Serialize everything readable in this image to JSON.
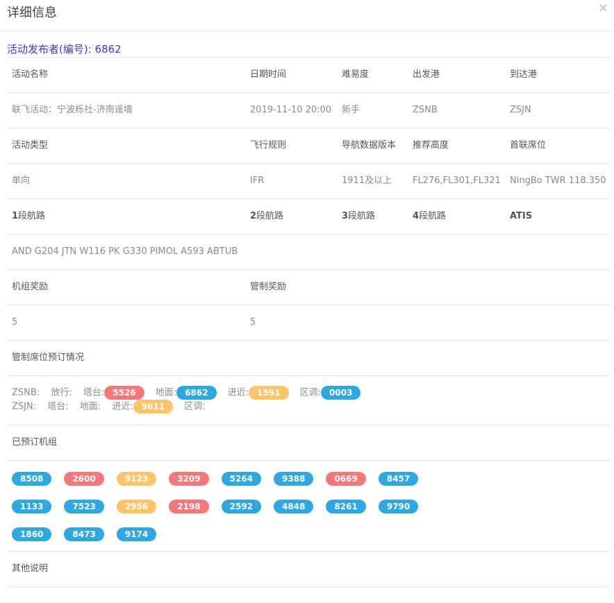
{
  "modal": {
    "title": "详细信息",
    "close_glyph": "×"
  },
  "publisher": {
    "label": "活动发布者(编号): 6862"
  },
  "table": {
    "row1_headers": [
      "活动名称",
      "日期时间",
      "难易度",
      "出发港",
      "到达港"
    ],
    "row1_values": [
      "联飞活动：宁波栎社-济南遥墙",
      "2019-11-10 20:00",
      "新手",
      "ZSNB",
      "ZSJN"
    ],
    "row2_headers": [
      "活动类型",
      "飞行规则",
      "导航数据版本",
      "推荐高度",
      "首联席位"
    ],
    "row2_values": [
      "单向",
      "IFR",
      "1911及以上",
      "FL276,FL301,FL321",
      "NingBo TWR 118.350"
    ],
    "row3_headers": [
      {
        "num": "1",
        "text": "段航路"
      },
      {
        "num": "2",
        "text": "段航路"
      },
      {
        "num": "3",
        "text": "段航路"
      },
      {
        "num": "4",
        "text": "段航路"
      },
      {
        "num": "",
        "text": "ATIS"
      }
    ],
    "route": "AND G204 JTN W116 PK G330 PIMOL A593 ABTUB",
    "reward_headers": [
      "机组奖励",
      "管制奖励"
    ],
    "reward_values": [
      "5",
      "5"
    ],
    "seat_title": "管制席位预订情况",
    "booked_title": "已预订机组",
    "other_title": "其他说明"
  },
  "seats": {
    "zsnb": {
      "airport": "ZSNB:",
      "release": "放行:",
      "tower": "塔台:",
      "tower_id": "5526",
      "ground": "地面:",
      "ground_id": "6862",
      "approach": "进近:",
      "approach_id": "1591",
      "area": "区调:",
      "area_id": "0003"
    },
    "zsjn": {
      "airport": "ZSJN:",
      "tower": "塔台:",
      "ground": "地面:",
      "approach": "进近:",
      "approach_id": "9611",
      "area": "区调:"
    }
  },
  "crews": [
    [
      {
        "id": "8508",
        "color": "blue"
      },
      {
        "id": "2600",
        "color": "red"
      },
      {
        "id": "9123",
        "color": "yellow"
      },
      {
        "id": "3209",
        "color": "red"
      },
      {
        "id": "5264",
        "color": "blue"
      },
      {
        "id": "9388",
        "color": "blue"
      },
      {
        "id": "0669",
        "color": "red"
      },
      {
        "id": "8457",
        "color": "blue"
      }
    ],
    [
      {
        "id": "1133",
        "color": "blue"
      },
      {
        "id": "7523",
        "color": "blue"
      },
      {
        "id": "2956",
        "color": "yellow"
      },
      {
        "id": "2198",
        "color": "red"
      },
      {
        "id": "2592",
        "color": "blue"
      },
      {
        "id": "4848",
        "color": "blue"
      },
      {
        "id": "8261",
        "color": "blue"
      },
      {
        "id": "9790",
        "color": "blue"
      }
    ],
    [
      {
        "id": "1860",
        "color": "blue"
      },
      {
        "id": "8473",
        "color": "blue"
      },
      {
        "id": "9174",
        "color": "blue"
      }
    ]
  ],
  "colors": {
    "blue": "#2ea8e0",
    "red": "#f57878",
    "yellow": "#fdc46a",
    "link": "#3b3bd6"
  }
}
